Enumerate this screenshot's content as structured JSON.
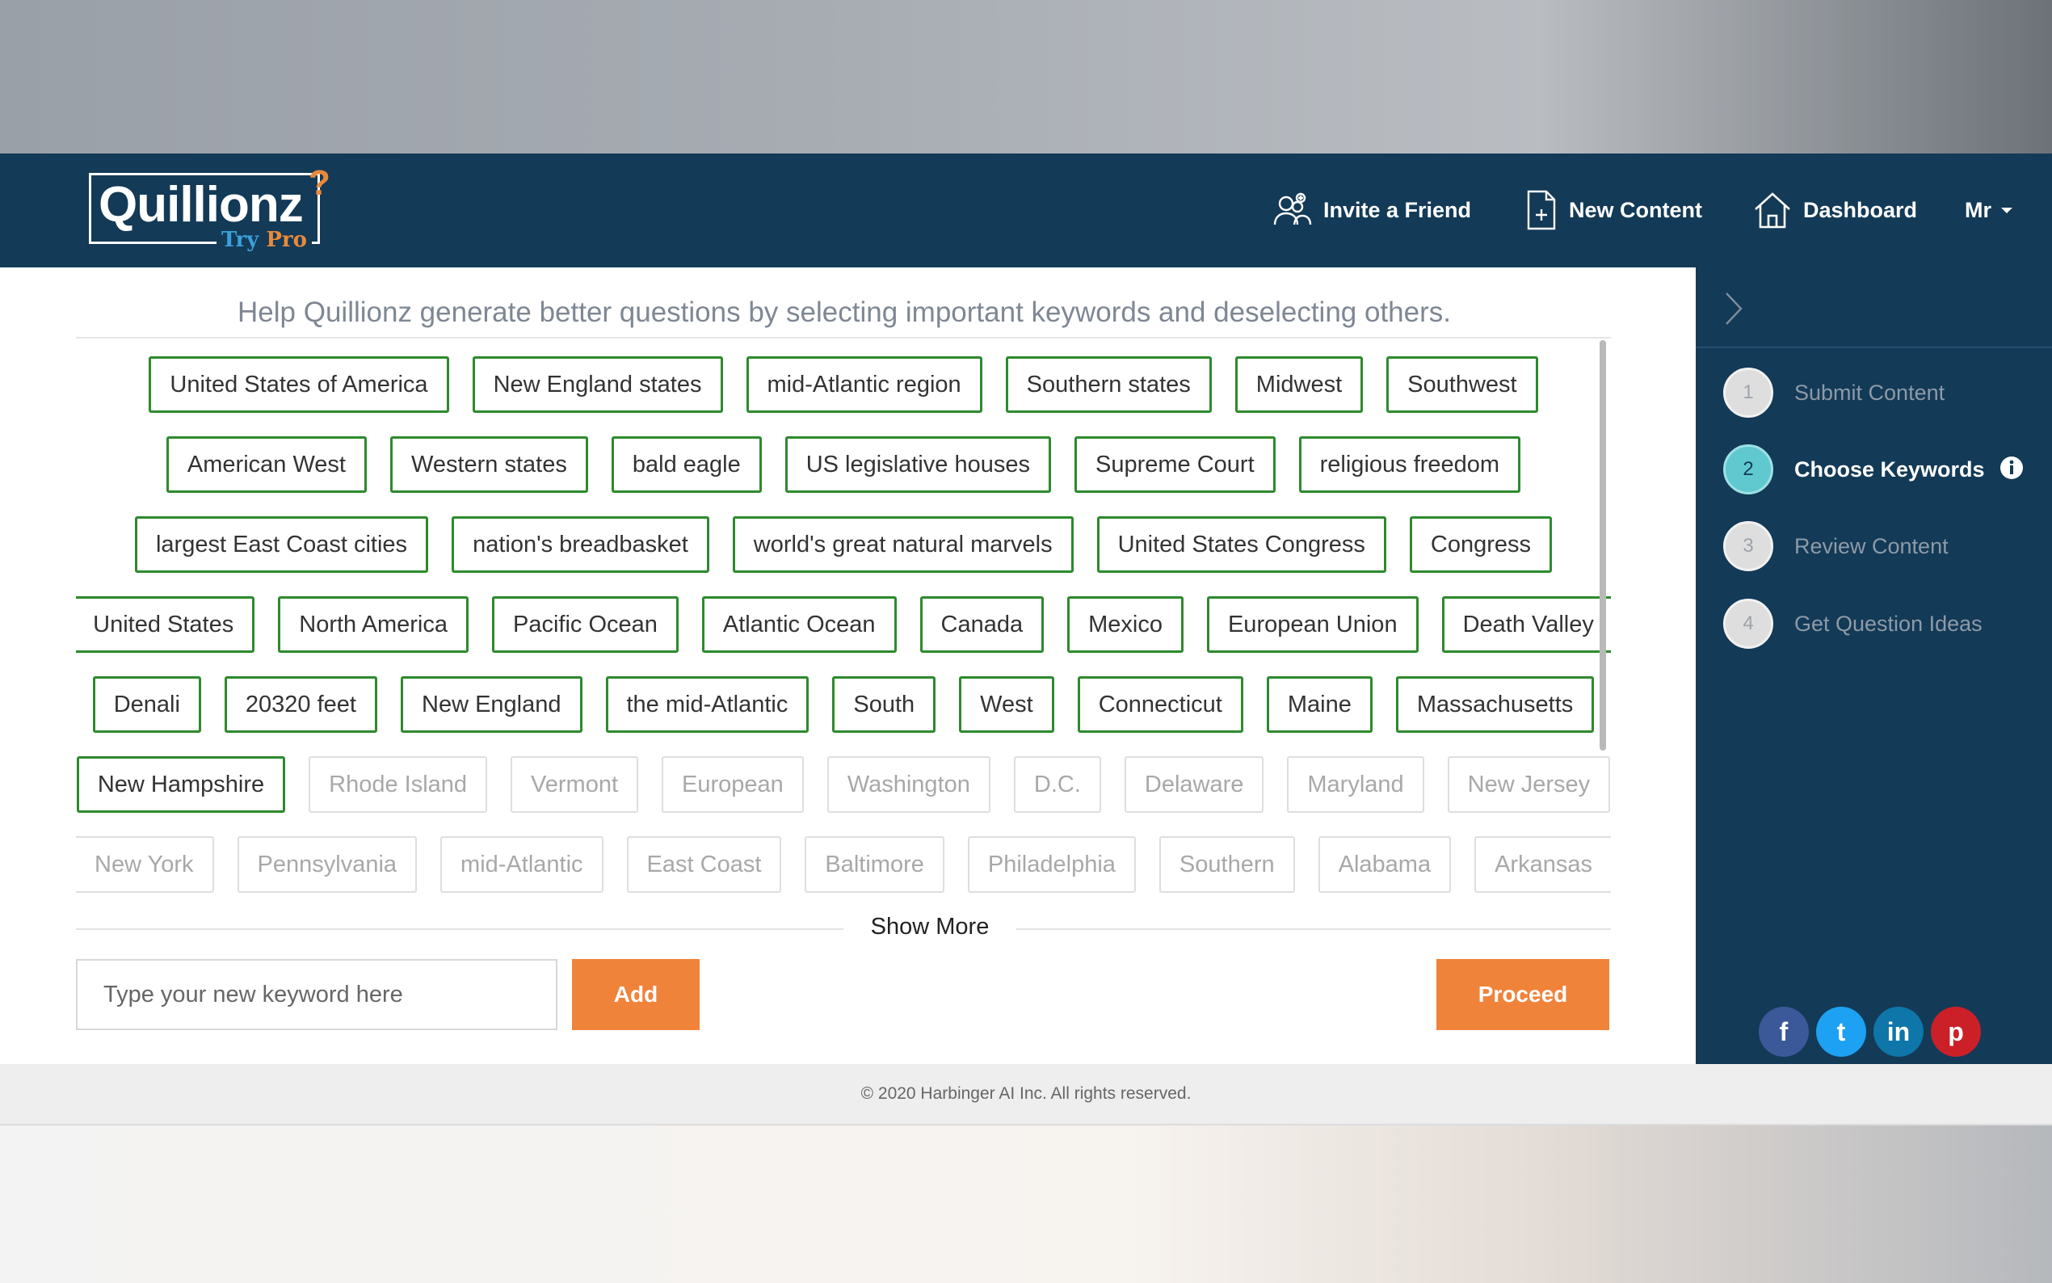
{
  "header": {
    "logo_text": "Quillionz",
    "logo_mark": "?",
    "logo_try": "Try",
    "logo_pro": "Pro",
    "nav": {
      "invite": "Invite a Friend",
      "new_content": "New Content",
      "dashboard": "Dashboard",
      "user": "Mr"
    }
  },
  "main": {
    "instruction": "Help Quillionz generate better questions by selecting important keywords and deselecting others.",
    "keyword_rows": [
      [
        {
          "label": "United States of America",
          "selected": true
        },
        {
          "label": "New England states",
          "selected": true
        },
        {
          "label": "mid-Atlantic region",
          "selected": true
        },
        {
          "label": "Southern states",
          "selected": true
        },
        {
          "label": "Midwest",
          "selected": true
        },
        {
          "label": "Southwest",
          "selected": true
        }
      ],
      [
        {
          "label": "American West",
          "selected": true
        },
        {
          "label": "Western states",
          "selected": true
        },
        {
          "label": "bald eagle",
          "selected": true
        },
        {
          "label": "US legislative houses",
          "selected": true
        },
        {
          "label": "Supreme Court",
          "selected": true
        },
        {
          "label": "religious freedom",
          "selected": true
        }
      ],
      [
        {
          "label": "largest East Coast cities",
          "selected": true
        },
        {
          "label": "nation's breadbasket",
          "selected": true
        },
        {
          "label": "world's great natural marvels",
          "selected": true
        },
        {
          "label": "United States Congress",
          "selected": true
        },
        {
          "label": "Congress",
          "selected": true
        }
      ],
      [
        {
          "label": "United States",
          "selected": true
        },
        {
          "label": "North America",
          "selected": true
        },
        {
          "label": "Pacific Ocean",
          "selected": true
        },
        {
          "label": "Atlantic Ocean",
          "selected": true
        },
        {
          "label": "Canada",
          "selected": true
        },
        {
          "label": "Mexico",
          "selected": true
        },
        {
          "label": "European Union",
          "selected": true
        },
        {
          "label": "Death Valley",
          "selected": true
        }
      ],
      [
        {
          "label": "Denali",
          "selected": true
        },
        {
          "label": "20320 feet",
          "selected": true
        },
        {
          "label": "New England",
          "selected": true
        },
        {
          "label": "the mid-Atlantic",
          "selected": true
        },
        {
          "label": "South",
          "selected": true
        },
        {
          "label": "West",
          "selected": true
        },
        {
          "label": "Connecticut",
          "selected": true
        },
        {
          "label": "Maine",
          "selected": true
        },
        {
          "label": "Massachusetts",
          "selected": true
        }
      ],
      [
        {
          "label": "New Hampshire",
          "selected": true
        },
        {
          "label": "Rhode Island",
          "selected": false
        },
        {
          "label": "Vermont",
          "selected": false
        },
        {
          "label": "European",
          "selected": false
        },
        {
          "label": "Washington",
          "selected": false
        },
        {
          "label": "D.C.",
          "selected": false
        },
        {
          "label": "Delaware",
          "selected": false
        },
        {
          "label": "Maryland",
          "selected": false
        },
        {
          "label": "New Jersey",
          "selected": false
        }
      ],
      [
        {
          "label": "New York",
          "selected": false
        },
        {
          "label": "Pennsylvania",
          "selected": false
        },
        {
          "label": "mid-Atlantic",
          "selected": false
        },
        {
          "label": "East Coast",
          "selected": false
        },
        {
          "label": "Baltimore",
          "selected": false
        },
        {
          "label": "Philadelphia",
          "selected": false
        },
        {
          "label": "Southern",
          "selected": false
        },
        {
          "label": "Alabama",
          "selected": false
        },
        {
          "label": "Arkansas",
          "selected": false
        }
      ]
    ],
    "show_more": "Show More",
    "keyword_input_placeholder": "Type your new keyword here",
    "add_label": "Add",
    "proceed_label": "Proceed"
  },
  "sidebar": {
    "steps": [
      {
        "num": "1",
        "label": "Submit Content",
        "active": false
      },
      {
        "num": "2",
        "label": "Choose Keywords",
        "active": true
      },
      {
        "num": "3",
        "label": "Review Content",
        "active": false
      },
      {
        "num": "4",
        "label": "Get Question Ideas",
        "active": false
      }
    ],
    "social": [
      {
        "name": "facebook-icon",
        "glyph": "f",
        "color": "#3b5998"
      },
      {
        "name": "twitter-icon",
        "glyph": "t",
        "color": "#1da1f2"
      },
      {
        "name": "linkedin-icon",
        "glyph": "in",
        "color": "#0e76a8"
      },
      {
        "name": "pinterest-icon",
        "glyph": "p",
        "color": "#cb2027"
      }
    ]
  },
  "footer": {
    "copyright": "© 2020 Harbinger AI Inc. All rights reserved."
  },
  "colors": {
    "header_bg": "#133a57",
    "accent_orange": "#f0833a",
    "chip_selected_border": "#2d8a2d",
    "step_active": "#5fc9cf"
  }
}
